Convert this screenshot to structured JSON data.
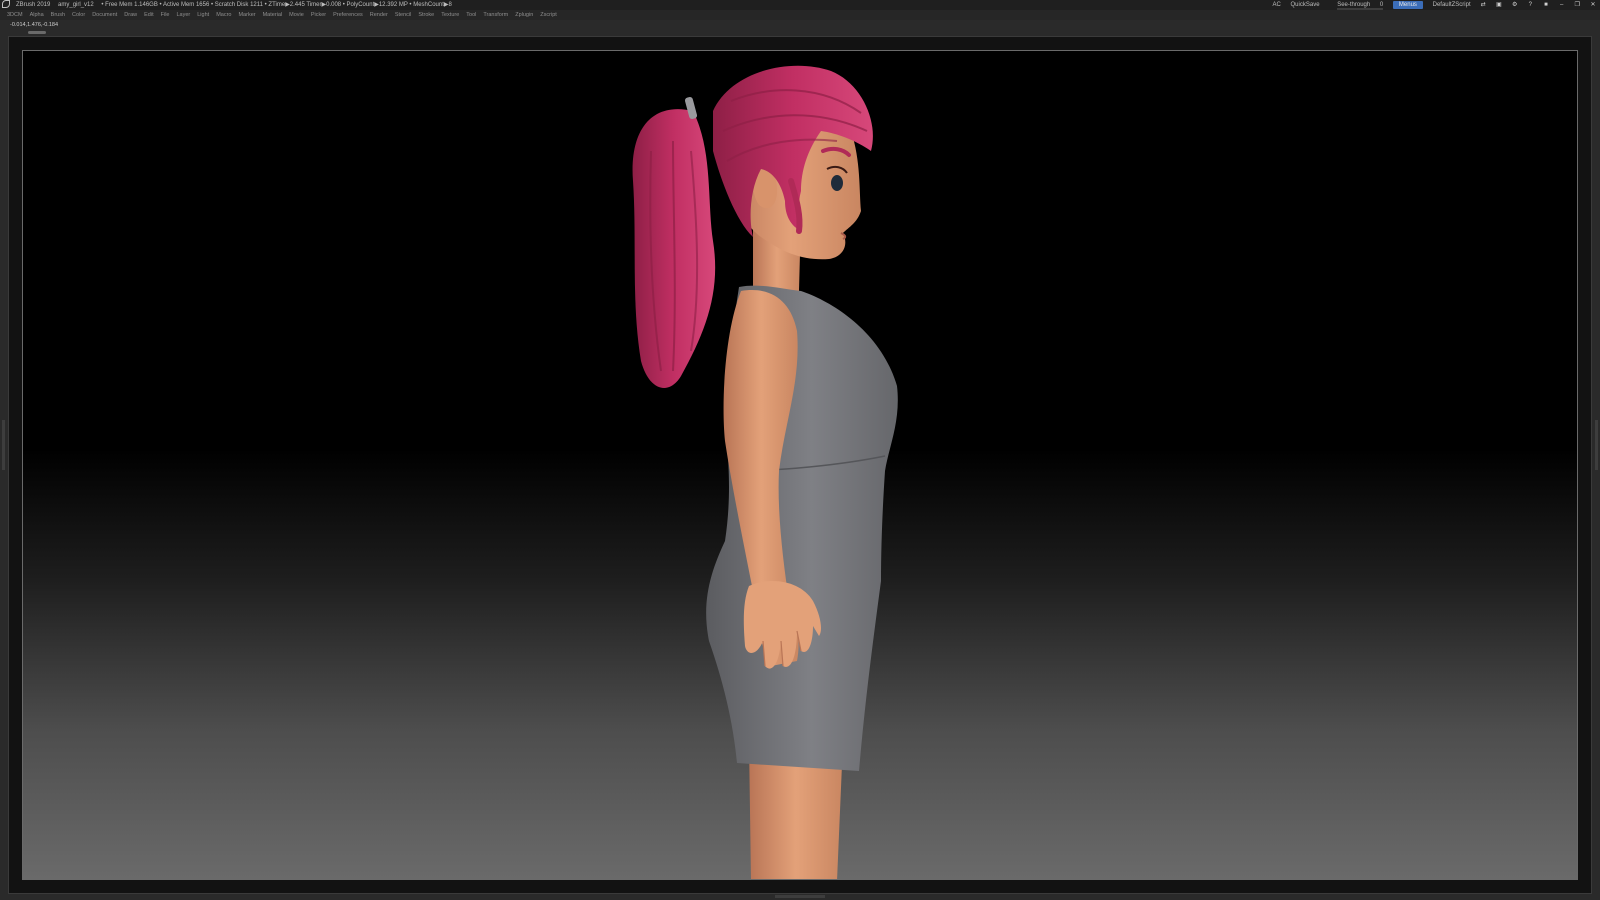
{
  "titlebar": {
    "app": "ZBrush 2019",
    "file": "amy_girl_v12",
    "stats": "• Free Mem 1.146GB • Active Mem 1656 • Scratch Disk 1211 • ZTime▶2.445 Timer▶0.008 • PolyCount▶12.392 MP • MeshCount▶8",
    "ac": "AC",
    "quicksave": "QuickSave",
    "see_through_label": "See-through",
    "see_through_value": "0",
    "see_through_fraction": 0,
    "menus_button": "Menus",
    "script": "DefaultZScript"
  },
  "menubar": {
    "items": [
      "3DCM",
      "Alpha",
      "Brush",
      "Color",
      "Document",
      "Draw",
      "Edit",
      "File",
      "Layer",
      "Light",
      "Macro",
      "Marker",
      "Material",
      "Movie",
      "Picker",
      "Preferences",
      "Render",
      "Stencil",
      "Stroke",
      "Texture",
      "Tool",
      "Transform",
      "Zplugin",
      "Zscript"
    ]
  },
  "coordbar": {
    "coords": "-0.014,1.476,-0.184"
  },
  "colors": {
    "hair": "#c12f63",
    "skin": "#e3a179",
    "dress": "#7b7c80",
    "accent": "#3b6db8"
  }
}
